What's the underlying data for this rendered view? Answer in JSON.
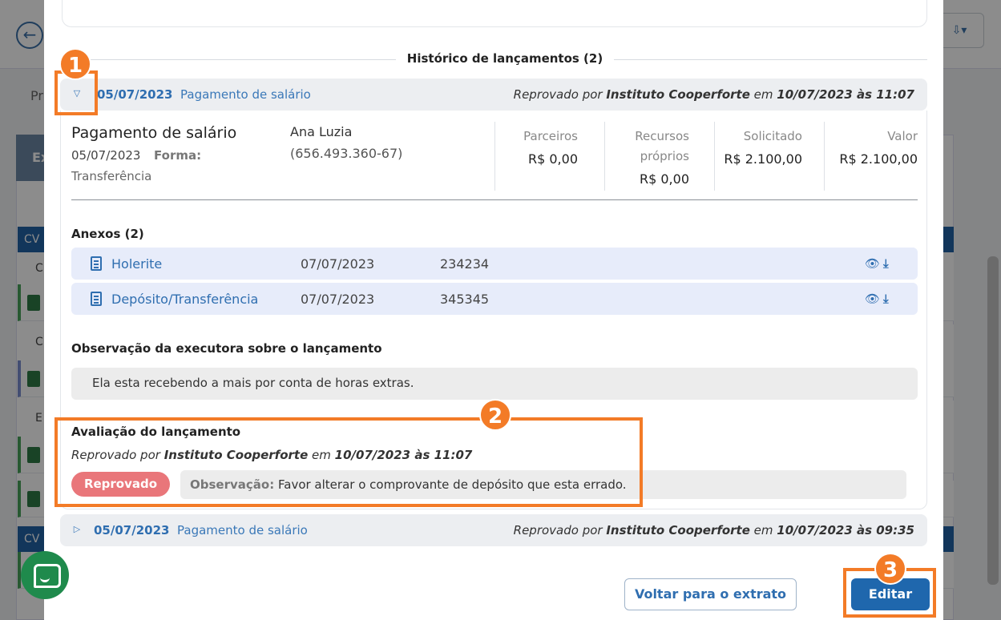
{
  "background": {
    "back_icon": "arrow-left-icon",
    "tab_partial": "Pr",
    "panel_head_partial": "Ex",
    "rowbar_label": "CV",
    "row_letters": [
      "C",
      "C",
      "E"
    ],
    "export_icon": "export-icon"
  },
  "history": {
    "title": "Histórico de lançamentos (2)"
  },
  "entries": [
    {
      "date": "05/07/2023",
      "description": "Pagamento de salário",
      "status_prefix": "Reprovado por",
      "status_org": "Instituto Cooperforte",
      "status_mid": "em",
      "status_when": "10/07/2023 às 11:07",
      "toggle_icon": "caret-down-icon"
    },
    {
      "date": "05/07/2023",
      "description": "Pagamento de salário",
      "status_prefix": "Reprovado por",
      "status_org": "Instituto Cooperforte",
      "status_mid": "em",
      "status_when": "10/07/2023 às 09:35",
      "toggle_icon": "caret-right-icon"
    }
  ],
  "detail": {
    "title": "Pagamento de salário",
    "date": "05/07/2023",
    "forma_label": "Forma:",
    "forma_value": "Transferência",
    "person_name": "Ana Luzia",
    "person_doc": "(656.493.360-67)",
    "values": [
      {
        "label": "Parceiros",
        "amount": "R$ 0,00"
      },
      {
        "label": "Recursos próprios",
        "amount": "R$ 0,00"
      },
      {
        "label": "Solicitado",
        "amount": "R$ 2.100,00"
      },
      {
        "label": "Valor",
        "amount": "R$ 2.100,00"
      }
    ]
  },
  "attachments": {
    "title": "Anexos (2)",
    "items": [
      {
        "name": "Holerite",
        "date": "07/07/2023",
        "number": "234234"
      },
      {
        "name": "Depósito/Transferência",
        "date": "07/07/2023",
        "number": "345345"
      }
    ]
  },
  "observation": {
    "title": "Observação da executora sobre o lançamento",
    "text": "Ela esta recebendo a mais por conta de horas extras."
  },
  "evaluation": {
    "title": "Avaliação do lançamento",
    "status_prefix": "Reprovado por",
    "status_org": "Instituto Cooperforte",
    "status_mid": "em",
    "status_when": "10/07/2023 às 11:07",
    "badge": "Reprovado",
    "obs_label": "Observação:",
    "obs_text": "Favor alterar o comprovante de depósito que esta errado."
  },
  "buttons": {
    "back": "Voltar para o extrato",
    "edit": "Editar"
  },
  "annotations": [
    "1",
    "2",
    "3"
  ],
  "colors": {
    "primary": "#1f67ad",
    "link": "#2f6eb0",
    "rejected": "#e9767a",
    "annotation": "#f37b27"
  }
}
